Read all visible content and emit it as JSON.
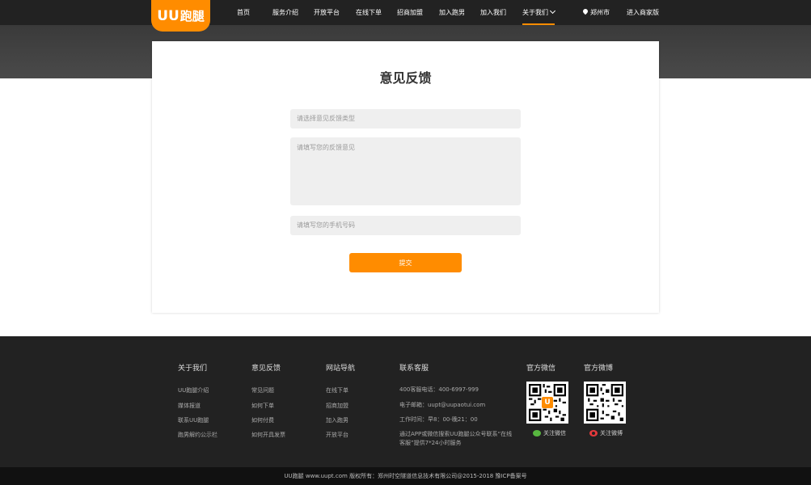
{
  "header": {
    "logo_uu": "UU",
    "logo_cn": "跑腿",
    "nav": [
      {
        "label": "首页"
      },
      {
        "label": "服务介绍"
      },
      {
        "label": "开放平台"
      },
      {
        "label": "在线下单"
      },
      {
        "label": "招商加盟"
      },
      {
        "label": "加入跑男"
      },
      {
        "label": "加入我们"
      },
      {
        "label": "关于我们"
      }
    ],
    "city": "郑州市",
    "merchant": "进入商家版"
  },
  "form": {
    "title": "意见反馈",
    "type_placeholder": "请选择意见反馈类型",
    "content_placeholder": "请填写您的反馈意见",
    "phone_placeholder": "请填写您的手机号码",
    "submit_label": "提交"
  },
  "footer": {
    "about": {
      "heading": "关于我们",
      "links": [
        "UU跑腿介绍",
        "媒体报道",
        "联系UU跑腿",
        "跑男解约公示栏"
      ]
    },
    "feedback": {
      "heading": "意见反馈",
      "links": [
        "常见问题",
        "如何下单",
        "如何付费",
        "如何开具发票"
      ]
    },
    "site_nav": {
      "heading": "网站导航",
      "links": [
        "在线下单",
        "招商加盟",
        "加入跑男",
        "开放平台"
      ]
    },
    "contact": {
      "heading": "联系客服",
      "phone": "400客服电话：400-6997-999",
      "email": "电子邮箱：uupt@uupaotui.com",
      "hours": "工作时间：早8：00-晚21：00",
      "note": "通过APP或微信搜索UU跑腿公众号联系“在线客服”提供7*24小时服务"
    },
    "wechat": {
      "heading": "官方微信",
      "label": "关注微信",
      "badge": "U"
    },
    "weibo": {
      "heading": "官方微博",
      "label": "关注微博"
    }
  },
  "copyright": "UU跑腿  www.uupt.com 版权所有：郑州时空隧道信息技术有限公司@2015-2018 豫ICP备案号"
}
